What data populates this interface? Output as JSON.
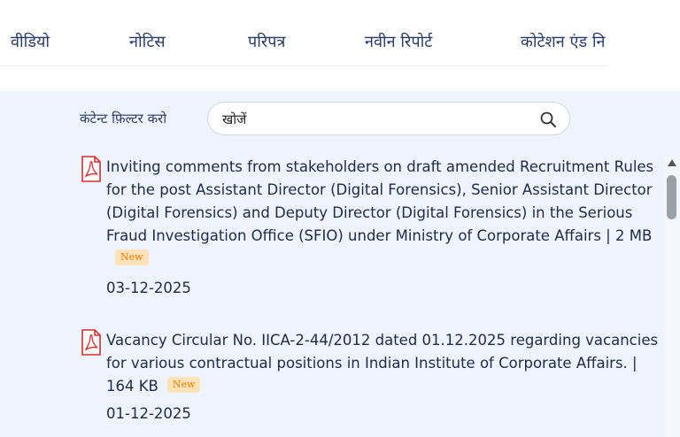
{
  "nav": {
    "tabs": [
      {
        "label": "वीडियो"
      },
      {
        "label": "नोटिस"
      },
      {
        "label": "परिपत्र"
      },
      {
        "label": "नवीन रिपोर्ट"
      },
      {
        "label": "कोटेशन एंड नि"
      }
    ]
  },
  "filter": {
    "label": "कंटेन्ट फ़िल्टर करो",
    "placeholder": "खोजें"
  },
  "items": [
    {
      "title": "Inviting comments from stakeholders on draft amended Recruitment Rules for the post Assistant Director (Digital Forensics), Senior Assistant Director (Digital Forensics) and Deputy Director (Digital Forensics) in the Serious Fraud Investigation Office (SFIO) under Ministry of Corporate Affairs | 2 MB",
      "badge": "New",
      "date": "03-12-2025"
    },
    {
      "title": "Vacancy Circular No. IICA-2-44/2012 dated 01.12.2025 regarding vacancies for various contractual positions in Indian Institute of Corporate Affairs. | 164 KB",
      "badge": "New",
      "date": "01-12-2025"
    }
  ],
  "colors": {
    "accent": "#2a3a66",
    "panel_bg": "#eef4fd",
    "badge_bg": "#ffe2b8",
    "badge_text": "#e07b00",
    "pdf_red": "#d32f2f"
  },
  "icons": {
    "pdf": "pdf-icon",
    "search": "search-icon"
  }
}
